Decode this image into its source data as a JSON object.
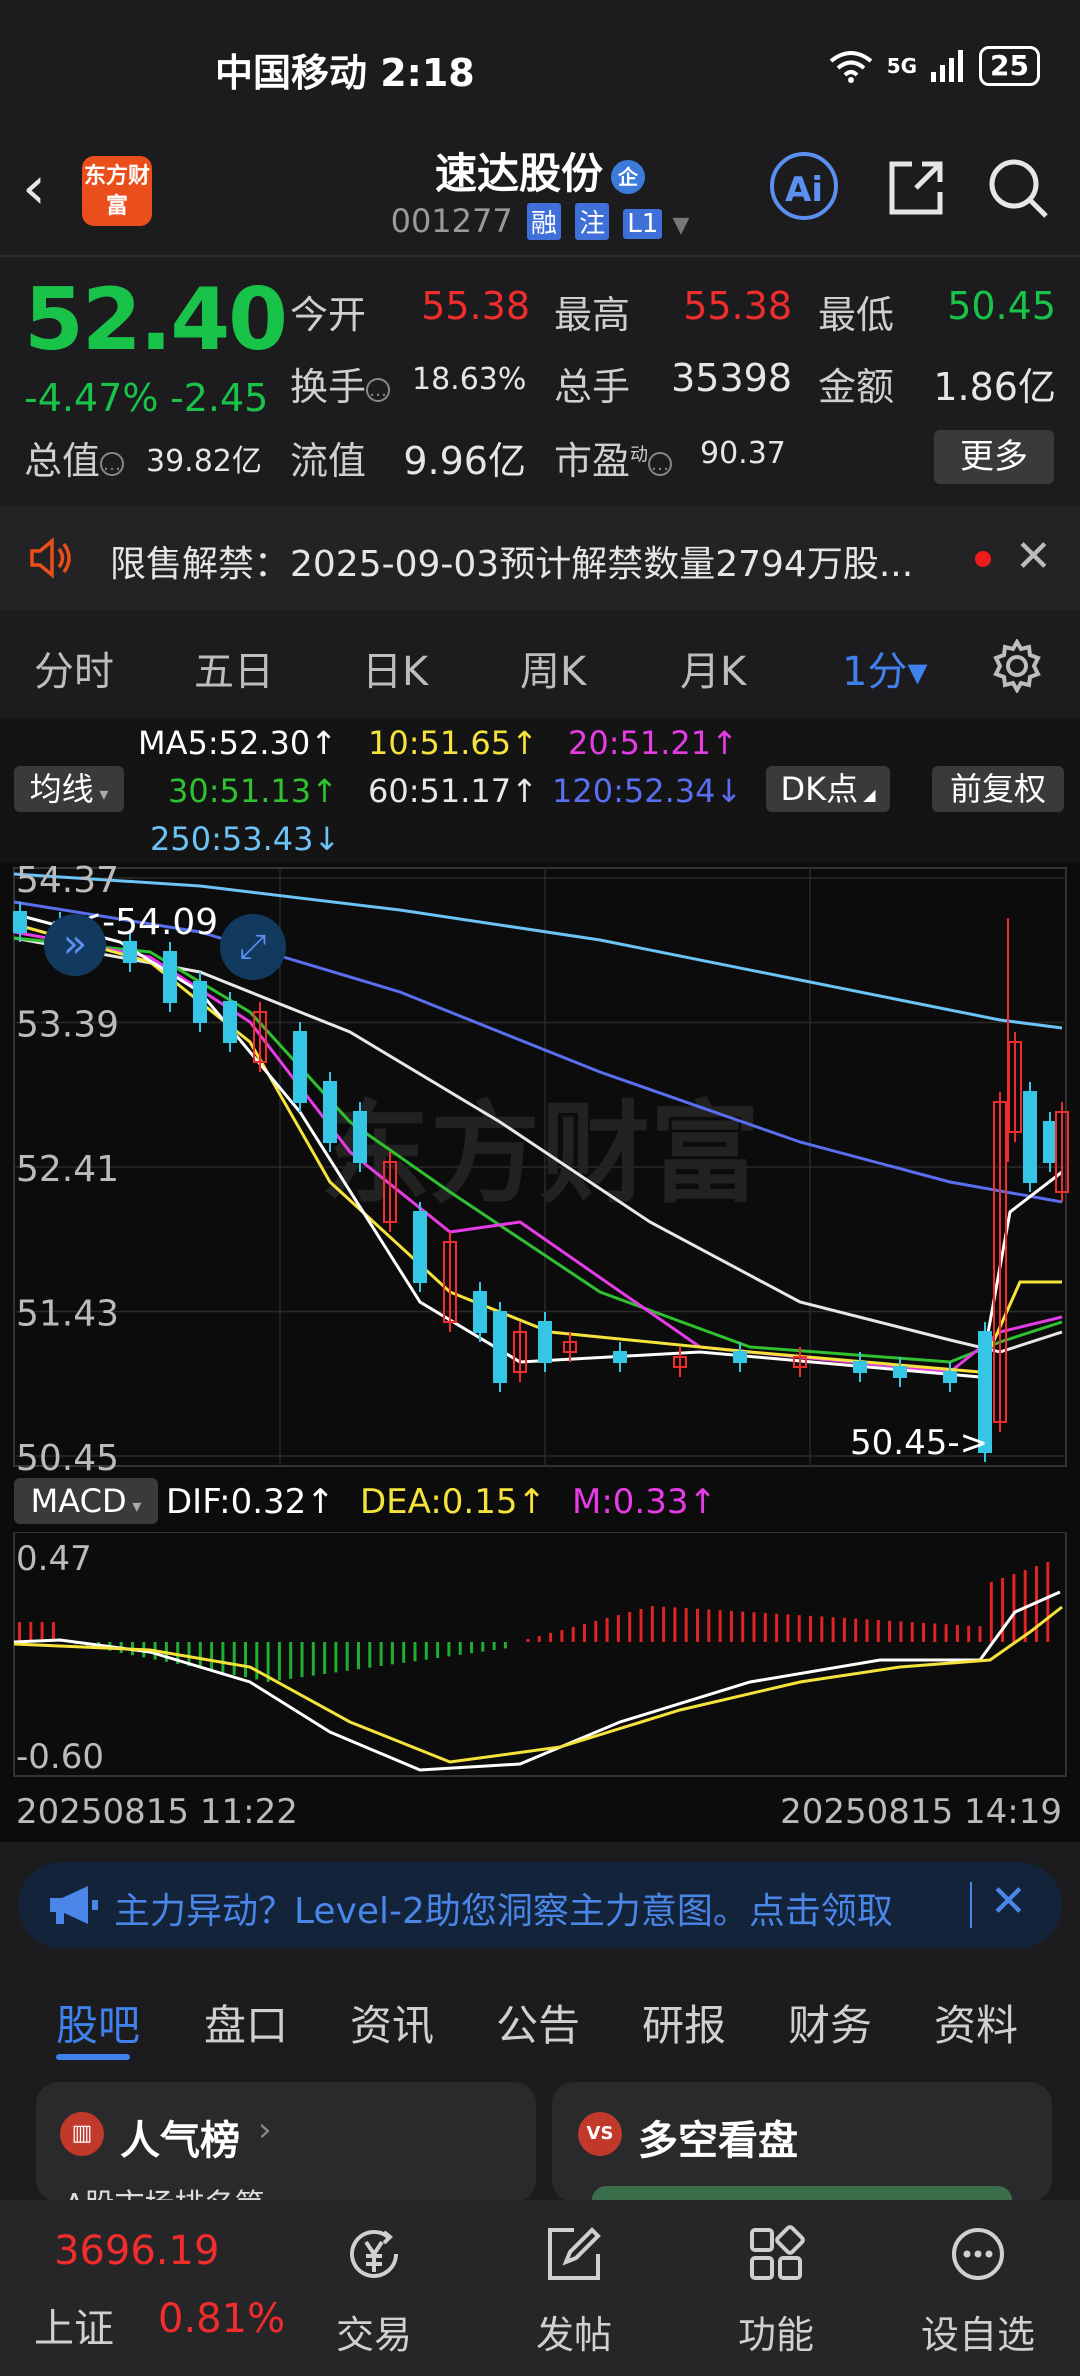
{
  "status_bar": {
    "carrier_time": "中国移动 2:18",
    "network": "5G",
    "battery": "25"
  },
  "header": {
    "back_icon": "‹",
    "logo_text": "东方财富",
    "stock_name": "速达股份",
    "badge": "企",
    "stock_code": "001277",
    "tags": [
      "融",
      "注",
      "L1"
    ],
    "ai_label": "Ai"
  },
  "quote": {
    "price": "52.40",
    "change_pct": "-4.47%",
    "change_abs": "-2.45",
    "open_label": "今开",
    "open": "55.38",
    "high_label": "最高",
    "high": "55.38",
    "low_label": "最低",
    "low": "50.45",
    "turnover_label": "换手",
    "turnover": "18.63%",
    "volume_label": "总手",
    "volume": "35398",
    "amount_label": "金额",
    "amount": "1.86亿",
    "mktcap_label": "总值",
    "mktcap": "39.82亿",
    "float_label": "流值",
    "float_cap": "9.96亿",
    "pe_label": "市盈",
    "pe_sup": "动",
    "pe": "90.37",
    "more_label": "更多",
    "colors": {
      "up": "#f02d2d",
      "down": "#19c34a"
    }
  },
  "notice": {
    "text": "限售解禁：2025-09-03预计解禁数量2794万股..."
  },
  "period_tabs": [
    "分时",
    "五日",
    "日K",
    "周K",
    "月K",
    "1分▾"
  ],
  "active_period": "1分▾",
  "ma": {
    "toggle": "均线",
    "ma5": "MA5:52.30↑",
    "ma10": "10:51.65↑",
    "ma20": "20:51.21↑",
    "ma30": "30:51.13↑",
    "ma60": "60:51.17↑",
    "ma120": "120:52.34↓",
    "ma250": "250:53.43↓",
    "dk_label": "DK点",
    "adjust_label": "前复权"
  },
  "chart_data": {
    "type": "candlestick",
    "y_ticks": [
      "54.37",
      "53.39",
      "52.41",
      "51.43",
      "50.45"
    ],
    "ylim": [
      50.45,
      54.37
    ],
    "high_marker": "54.09",
    "low_marker": "50.45->",
    "watermark": "东方财富",
    "macd": {
      "toggle": "MACD",
      "dif": "DIF:0.32↑",
      "dea": "DEA:0.15↑",
      "m": "M:0.33↑",
      "y_ticks": [
        "0.47",
        "-0.60"
      ]
    },
    "time_start": "20250815 11:22",
    "time_end": "20250815 14:19"
  },
  "promo": {
    "text": "主力异动？Level-2助您洞察主力意图。点击领取"
  },
  "sub_tabs": [
    "股吧",
    "盘口",
    "资讯",
    "公告",
    "研报",
    "财务",
    "资料"
  ],
  "cards": [
    {
      "title": "人气榜",
      "icon": "rank-icon",
      "sub": "A股市场排名第"
    },
    {
      "title": "多空看盘",
      "icon": "vs-icon"
    }
  ],
  "bottom_nav": {
    "index_value": "3696.19",
    "index_name": "上证",
    "index_change": "0.81%",
    "items": [
      "交易",
      "发帖",
      "功能",
      "设自选"
    ]
  }
}
